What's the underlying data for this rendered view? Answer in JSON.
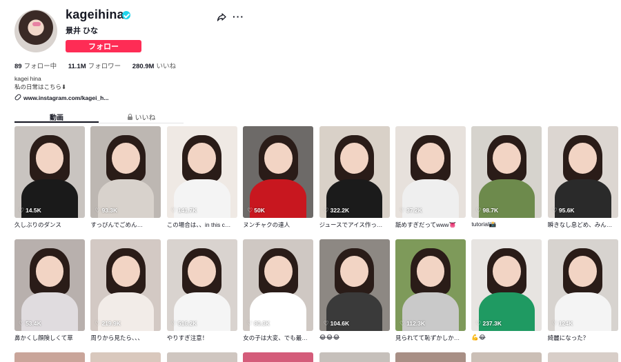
{
  "profile": {
    "username": "kageihina",
    "nickname": "景井 ひな",
    "follow_label": "フォロー",
    "stats": {
      "following_count": "89",
      "following_label": "フォロー中",
      "followers_count": "11.1M",
      "followers_label": "フォロワー",
      "likes_count": "280.9M",
      "likes_label": "いいね"
    },
    "bio_line1": "kagei hina",
    "bio_line2": "私の日常はこちら⬇",
    "link": "www.instagram.com/kagei_h..."
  },
  "tabs": {
    "videos": "動画",
    "liked": "いいね"
  },
  "colors": {
    "accent": "#fe2c55",
    "verified": "#20d5ec"
  },
  "videos": [
    {
      "views": "14.5K",
      "caption": "久しぶりのダンス",
      "bg": "#c9c4c0",
      "body": "#1a1a1a"
    },
    {
      "views": "93.3K",
      "caption": "すっぴんでごめん…",
      "bg": "#bdb7b2",
      "body": "#d8d2cc"
    },
    {
      "views": "141.7K",
      "caption": "この場合は、、in this c…",
      "bg": "#efe9e4",
      "body": "#f4f4f4"
    },
    {
      "views": "50K",
      "caption": "ヌンチャクの達人",
      "bg": "#6d6a68",
      "body": "#c8171f"
    },
    {
      "views": "322.2K",
      "caption": "ジュースでアイス作っ…",
      "bg": "#d9d1c8",
      "body": "#1b1b1b"
    },
    {
      "views": "37.2K",
      "caption": "舐めすぎだってwww👅",
      "bg": "#e7e1dc",
      "body": "#efefef"
    },
    {
      "views": "98.7K",
      "caption": "tutorial📸",
      "bg": "#d6d3cd",
      "body": "#6d8a4c"
    },
    {
      "views": "95.6K",
      "caption": "瞬きなし息どめ、みん…",
      "bg": "#dcd6d1",
      "body": "#2a2a2a"
    },
    {
      "views": "53.4K",
      "caption": "鼻かくし顔険しくて草",
      "bg": "#b8b0ad",
      "body": "#e0dcdf"
    },
    {
      "views": "219.9K",
      "caption": "周りから見たら、、、",
      "bg": "#d3c9c4",
      "body": "#f2ece8"
    },
    {
      "views": "516.2K",
      "caption": "やりすぎ注意！",
      "bg": "#d9d3cf",
      "body": "#f5f5f5"
    },
    {
      "views": "80.3K",
      "caption": "女の子は大変、でも最…",
      "bg": "#cfc8c3",
      "body": "#ffffff"
    },
    {
      "views": "104.6K",
      "caption": "😂😂😂",
      "bg": "#8d8883",
      "body": "#3a3a3a"
    },
    {
      "views": "112.3K",
      "caption": "見られてて恥ずかしか…",
      "bg": "#7e9a5a",
      "body": "#c9c9c9"
    },
    {
      "views": "237.3K",
      "caption": "💪😂",
      "bg": "#e7e4e1",
      "body": "#1f9a62"
    },
    {
      "views": "124K",
      "caption": "綺麗になった？",
      "bg": "#d7d3cf",
      "body": "#f4f4f4"
    }
  ],
  "peek_colors": [
    "#c9a59a",
    "#d9c8bd",
    "#cfc6c0",
    "#d45c7a",
    "#c6c0bb",
    "#a88f85",
    "#cbbfb6",
    "#d8cec8"
  ]
}
